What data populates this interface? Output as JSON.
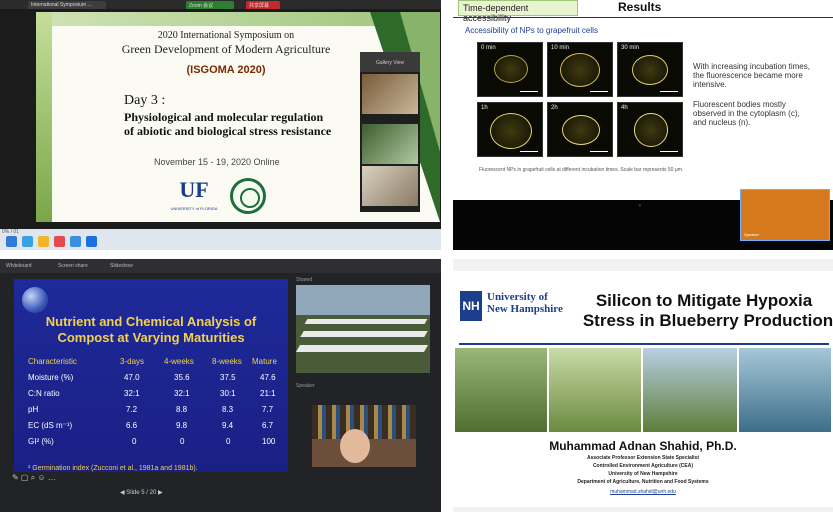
{
  "q1": {
    "tabs": [
      "International Symposium ...",
      "Zoom 会议",
      "共享屏幕"
    ],
    "slide": {
      "symposium_line1": "2020 International Symposium on",
      "symposium_line2": "Green Development of Modern Agriculture",
      "acronym": "(ISGOMA 2020)",
      "day": "Day 3 :",
      "topic_line1": "Physiological and molecular regulation",
      "topic_line2": "of abiotic and biological stress resistance",
      "dates": "November 15 - 19, 2020   Online",
      "logo_uf": "UF",
      "logo_uf_sub": "UNIVERSITY of FLORIDA"
    },
    "video_header": "Gallery View",
    "status_text": "0% / 01"
  },
  "q2": {
    "tag": "Time-dependent accessibility",
    "heading": "Results",
    "subtitle": "Accessibility of NPs to grapefruit cells",
    "panel_labels": [
      "0 min",
      "10 min",
      "30 min",
      "1h",
      "2h",
      "4h"
    ],
    "caption": "Fluorescent NPs in grapefruit cells at different incubation times. Scale bar represents 50 μm.",
    "bullet1": "With increasing incubation times, the fluorescence became more intensive.",
    "bullet2": "Fluorescent bodies mostly observed in the cytoplasm (c), and nucleus (n).",
    "speaker_label": "Speaker"
  },
  "q3": {
    "tabs": [
      "Whiteboard",
      "Screen share",
      "Slideshow"
    ],
    "slide": {
      "heading_line1": "Nutrient and Chemical Analysis of",
      "heading_line2": "Compost at Varying Maturities",
      "columns": [
        "Characteristic",
        "3-days",
        "4-weeks",
        "8-weeks",
        "Mature"
      ],
      "rows": [
        [
          "Moisture (%)",
          "47.0",
          "35.6",
          "37.5",
          "47.6"
        ],
        [
          "C:N ratio",
          "32:1",
          "32:1",
          "30:1",
          "21:1"
        ],
        [
          "pH",
          "7.2",
          "8.8",
          "8.3",
          "7.7"
        ],
        [
          "EC (dS m⁻¹)",
          "6.6",
          "9.8",
          "9.4",
          "6.7"
        ],
        [
          "GI² (%)",
          "0",
          "0",
          "0",
          "100"
        ]
      ],
      "footnote": "²  Germination index (Zucconi et al., 1981a and 1981b)."
    },
    "side_label_1": "Shared",
    "side_label_2": "Speaker",
    "tools": "✎ ▢ ⌕ ☺ …",
    "pager": "◀  Slide 5 / 20  ▶"
  },
  "q4": {
    "logo_nh": "NH",
    "university_line1": "University of",
    "university_line2": "New Hampshire",
    "title_line1": "Silicon to Mitigate Hypoxia",
    "title_line2": "Stress in Blueberry Production",
    "name": "Muhammad Adnan Shahid, Ph.D.",
    "info_lines": [
      "Associate Professor Extension State Specialist",
      "Controlled Environment Agriculture (CEA)",
      "University of New Hampshire",
      "Department of Agriculture, Nutrition and Food Systems"
    ],
    "email": "muhammad.shahid@unh.edu"
  },
  "colors": {
    "uf_blue": "#1b3c8c",
    "slide_green": "#2e6b2a",
    "compost_heading": "#f3d24b",
    "compost_bg": "#1e2a9a",
    "unh_blue": "#1c3e8c"
  }
}
